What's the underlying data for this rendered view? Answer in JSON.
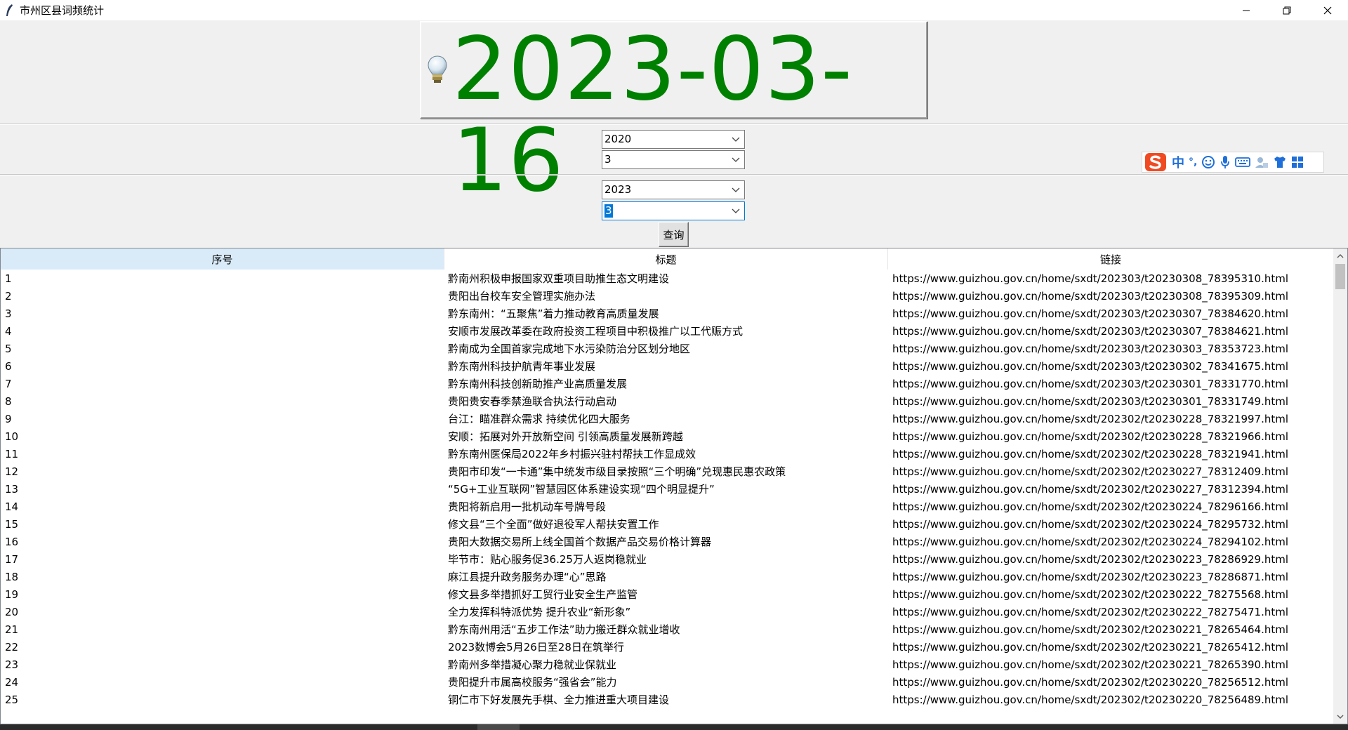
{
  "window": {
    "title": "市州区县词频统计",
    "controls": [
      "minimize-icon",
      "restore-icon",
      "close-icon"
    ]
  },
  "banner": {
    "date": "2023-03-16",
    "icon": "lightbulb-icon",
    "color": "#008000"
  },
  "start": {
    "year": "2020",
    "month": "3"
  },
  "end": {
    "year": "2023",
    "month": "3"
  },
  "query_button": "查询",
  "ime": {
    "mode": "中",
    "punct": "°,"
  },
  "table": {
    "headers": [
      "序号",
      "标题",
      "链接"
    ],
    "rows": [
      [
        "1",
        "黔南州积极申报国家双重项目助推生态文明建设",
        "https://www.guizhou.gov.cn/home/sxdt/202303/t20230308_78395310.html"
      ],
      [
        "2",
        "贵阳出台校车安全管理实施办法",
        "https://www.guizhou.gov.cn/home/sxdt/202303/t20230308_78395309.html"
      ],
      [
        "3",
        "黔东南州：“五聚焦”着力推动教育高质量发展",
        "https://www.guizhou.gov.cn/home/sxdt/202303/t20230307_78384620.html"
      ],
      [
        "4",
        "安顺市发展改革委在政府投资工程项目中积极推广以工代赈方式",
        "https://www.guizhou.gov.cn/home/sxdt/202303/t20230307_78384621.html"
      ],
      [
        "5",
        "黔南成为全国首家完成地下水污染防治分区划分地区",
        "https://www.guizhou.gov.cn/home/sxdt/202303/t20230303_78353723.html"
      ],
      [
        "6",
        "黔东南州科技护航青年事业发展",
        "https://www.guizhou.gov.cn/home/sxdt/202303/t20230302_78341675.html"
      ],
      [
        "7",
        "黔东南州科技创新助推产业高质量发展",
        "https://www.guizhou.gov.cn/home/sxdt/202303/t20230301_78331770.html"
      ],
      [
        "8",
        "贵阳贵安春季禁渔联合执法行动启动",
        "https://www.guizhou.gov.cn/home/sxdt/202303/t20230301_78331749.html"
      ],
      [
        "9",
        "台江：瞄准群众需求 持续优化四大服务",
        "https://www.guizhou.gov.cn/home/sxdt/202302/t20230228_78321997.html"
      ],
      [
        "10",
        "安顺：拓展对外开放新空间 引领高质量发展新跨越",
        "https://www.guizhou.gov.cn/home/sxdt/202302/t20230228_78321966.html"
      ],
      [
        "11",
        "黔东南州医保局2022年乡村振兴驻村帮扶工作显成效",
        "https://www.guizhou.gov.cn/home/sxdt/202302/t20230228_78321941.html"
      ],
      [
        "12",
        "贵阳市印发“一卡通”集中统发市级目录按照“三个明确”兑现惠民惠农政策",
        "https://www.guizhou.gov.cn/home/sxdt/202302/t20230227_78312409.html"
      ],
      [
        "13",
        "“5G+工业互联网”智慧园区体系建设实现“四个明显提升”",
        "https://www.guizhou.gov.cn/home/sxdt/202302/t20230227_78312394.html"
      ],
      [
        "14",
        "贵阳将新启用一批机动车号牌号段",
        "https://www.guizhou.gov.cn/home/sxdt/202302/t20230224_78296166.html"
      ],
      [
        "15",
        "修文县“三个全面”做好退役军人帮扶安置工作",
        "https://www.guizhou.gov.cn/home/sxdt/202302/t20230224_78295732.html"
      ],
      [
        "16",
        "贵阳大数据交易所上线全国首个数据产品交易价格计算器",
        "https://www.guizhou.gov.cn/home/sxdt/202302/t20230224_78294102.html"
      ],
      [
        "17",
        "毕节市：贴心服务促36.25万人返岗稳就业",
        "https://www.guizhou.gov.cn/home/sxdt/202302/t20230223_78286929.html"
      ],
      [
        "18",
        "麻江县提升政务服务办理“心”思路",
        "https://www.guizhou.gov.cn/home/sxdt/202302/t20230223_78286871.html"
      ],
      [
        "19",
        "修文县多举措抓好工贸行业安全生产监管",
        "https://www.guizhou.gov.cn/home/sxdt/202302/t20230222_78275568.html"
      ],
      [
        "20",
        "全力发挥科特派优势 提升农业“新形象”",
        "https://www.guizhou.gov.cn/home/sxdt/202302/t20230222_78275471.html"
      ],
      [
        "21",
        "黔东南州用活“五步工作法”助力搬迁群众就业增收",
        "https://www.guizhou.gov.cn/home/sxdt/202302/t20230221_78265464.html"
      ],
      [
        "22",
        "2023数博会5月26日至28日在筑举行",
        "https://www.guizhou.gov.cn/home/sxdt/202302/t20230221_78265412.html"
      ],
      [
        "23",
        "黔南州多举措凝心聚力稳就业保就业",
        "https://www.guizhou.gov.cn/home/sxdt/202302/t20230221_78265390.html"
      ],
      [
        "24",
        "贵阳提升市属高校服务“强省会”能力",
        "https://www.guizhou.gov.cn/home/sxdt/202302/t20230220_78256512.html"
      ],
      [
        "25",
        "铜仁市下好发展先手棋、全力推进重大项目建设",
        "https://www.guizhou.gov.cn/home/sxdt/202302/t20230220_78256489.html"
      ]
    ]
  }
}
